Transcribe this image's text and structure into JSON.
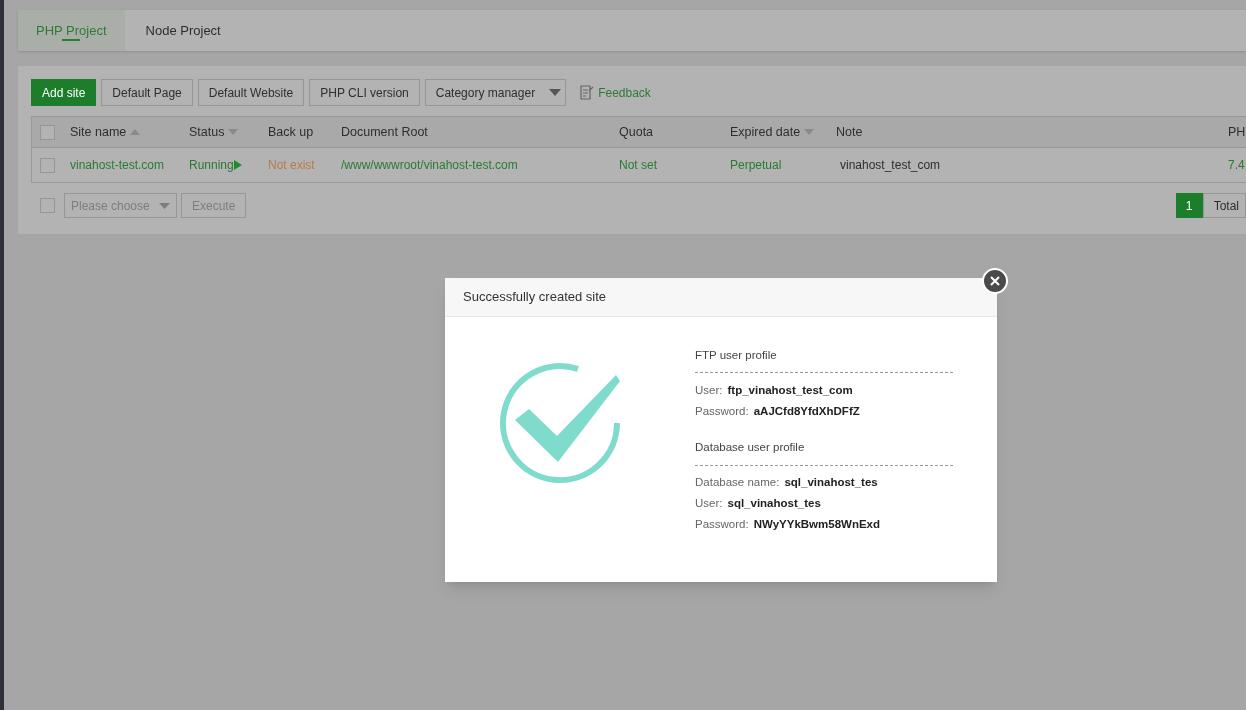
{
  "tabs": [
    {
      "label": "PHP Project",
      "selected": true
    },
    {
      "label": "Node Project",
      "selected": false
    }
  ],
  "toolbar": {
    "buttons": [
      {
        "label": "Add site",
        "kind": "primary"
      },
      {
        "label": "Default Page",
        "kind": "default"
      },
      {
        "label": "Default Website",
        "kind": "default"
      },
      {
        "label": "PHP CLI version",
        "kind": "default"
      },
      {
        "label": "Category manager",
        "kind": "dropdown"
      }
    ],
    "feedback": "Feedback"
  },
  "table": {
    "all_checked": false,
    "columns": [
      {
        "label": "Site name",
        "kind": "ascending"
      },
      {
        "label": "Status",
        "kind": "descending"
      },
      {
        "label": "Back up",
        "kind": "plain"
      },
      {
        "label": "Document Root",
        "kind": "plain"
      },
      {
        "label": "Quota",
        "kind": "plain"
      },
      {
        "label": "Expired date",
        "kind": "descending"
      },
      {
        "label": "Note",
        "kind": "plain"
      },
      {
        "label": "PH",
        "kind": "plain"
      }
    ],
    "rows": [
      {
        "checked": false,
        "cells": [
          {
            "text": "vinahost-test.com",
            "kind": "link"
          },
          {
            "text": "Running",
            "kind": "status"
          },
          {
            "text": "Not exist",
            "kind": "warning"
          },
          {
            "text": "/www/wwwroot/vinahost-test.com",
            "kind": "link"
          },
          {
            "text": "Not set",
            "kind": "link"
          },
          {
            "text": "Perpetual",
            "kind": "link"
          },
          {
            "text": "vinahost_test_com",
            "kind": "plain"
          },
          {
            "text": "7.4",
            "kind": "link"
          }
        ]
      }
    ]
  },
  "bulk": {
    "checked": false,
    "placeholder": "Please choose",
    "button": "Execute"
  },
  "pagination": {
    "pages": [
      {
        "label": "1",
        "selected": true
      }
    ],
    "total": "Total"
  },
  "dialog": {
    "title": "Successfully created site",
    "sections": [
      {
        "heading": "FTP user profile",
        "fields": [
          {
            "label": "User:",
            "value": "ftp_vinahost_test_com"
          },
          {
            "label": "Password:",
            "value": "aAJCfd8YfdXhDFfZ"
          }
        ]
      },
      {
        "heading": "Database user profile",
        "fields": [
          {
            "label": "Database name:",
            "value": "sql_vinahost_tes"
          },
          {
            "label": "User:",
            "value": "sql_vinahost_tes"
          },
          {
            "label": "Password:",
            "value": "NWyYYkBwm58WnExd"
          }
        ]
      }
    ]
  }
}
